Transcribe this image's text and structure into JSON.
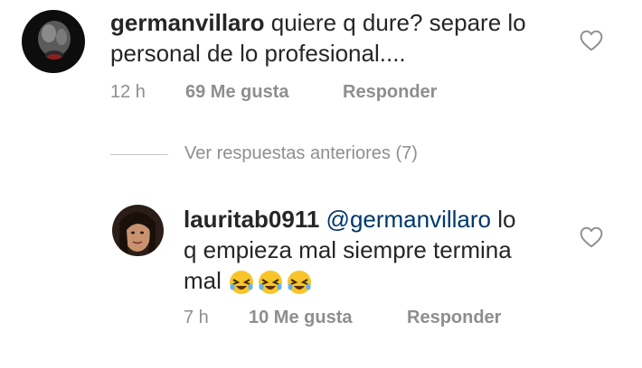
{
  "comments": [
    {
      "username": "germanvillaro",
      "text": "quiere q dure? separe lo personal de lo profesional....",
      "time": "12 h",
      "likes": "69 Me gusta",
      "reply": "Responder"
    },
    {
      "username": "lauritab0911",
      "mention": "@germanvillaro",
      "text_a": "lo",
      "text_b": "q empieza mal siempre termina",
      "text_c": "mal",
      "emojis": [
        "rolling-on-floor-laughing",
        "rolling-on-floor-laughing",
        "rolling-on-floor-laughing"
      ],
      "time": "7 h",
      "likes": "10 Me gusta",
      "reply": "Responder"
    }
  ],
  "view_replies_label": "Ver respuestas anteriores (7)",
  "icons": {
    "like": "heart-outline-icon"
  },
  "colors": {
    "text": "#262626",
    "secondary": "#8e8e8e",
    "mention": "#00376b",
    "divider": "#c7c7c7"
  }
}
